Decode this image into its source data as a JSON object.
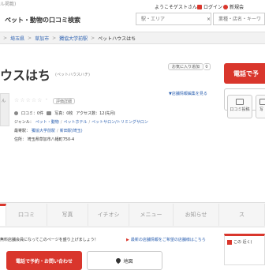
{
  "header": {
    "top_fragment": "ル掲載)",
    "site_title": "ペット・動物の口コミ検索",
    "welcome": "ようこそゲストさん",
    "login": "ログイン",
    "register": "新規会",
    "area_placeholder": "駅・エリア",
    "keyword_placeholder": "業種・店名・キーワ"
  },
  "breadcrumb": {
    "prefix": ">",
    "items": [
      "埼玉県",
      "草加市",
      "獨協大学前駅",
      "ペットハウスはち"
    ]
  },
  "shop": {
    "name_fragment": "ウスはち",
    "kana": "(ペットハウスハチ)",
    "favorite_button": "お気に入り追加",
    "favorite_count": "0",
    "photo_label_fragment": "ん",
    "rating_label": "評価詳細",
    "reviews": "口コミ：0件",
    "photos": "写真：0枚",
    "access": "アクセス数：12(先月)",
    "genre_label": "ジャンル：",
    "genres": [
      "ペット・動物",
      "ペットホテル",
      "ペットサロン/トリミングサロン"
    ],
    "station_label": "最寄駅：",
    "stations": [
      "獨協大学前駅",
      "新田駅(埼玉)"
    ],
    "address": "住所： 埼玉県草加市八幡町750-4",
    "edit_link": "▼店舗情報編集を見る"
  },
  "right_panel": {
    "phone_button_fragment": "電話で予",
    "review_post": "口コミ投稿",
    "photo_post_fragment": "写"
  },
  "tabs": [
    "口コミ",
    "写真",
    "イチオシ",
    "メニュー",
    "お知らせ",
    "ス"
  ],
  "notice": {
    "text": "無料店舗会員になってこのページを盛り上げましょう！",
    "link": "最新の店舗情報をご希望の店舗様はこちら"
  },
  "bottom_actions": {
    "phone": "電話で予約・お問い合わせ",
    "map": "地図"
  },
  "sidebar": {
    "nearby_fragment": "この 近く("
  },
  "colors": {
    "accent": "#d9362c",
    "link": "#2a5fb0"
  }
}
